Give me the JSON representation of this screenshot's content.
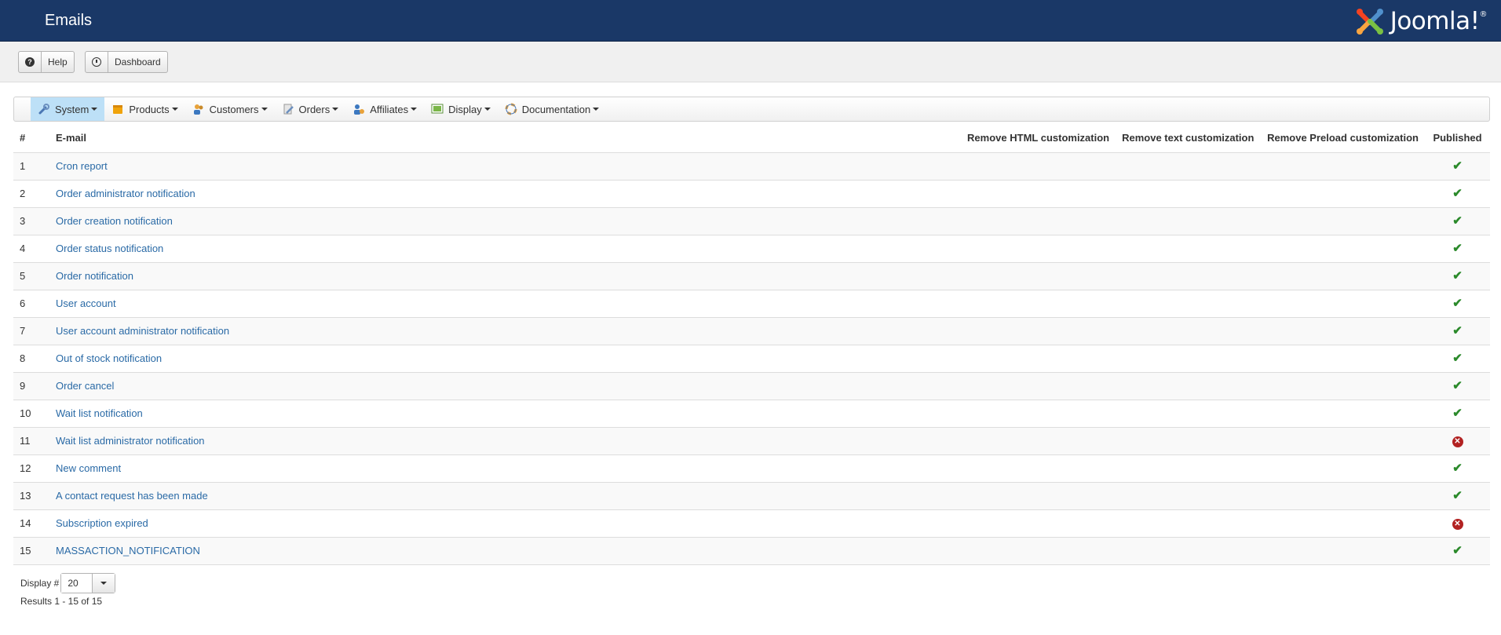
{
  "header": {
    "title": "Emails",
    "logo_text": "Joomla!"
  },
  "toolbar": {
    "help_label": "Help",
    "dashboard_label": "Dashboard"
  },
  "menu": [
    {
      "label": "System",
      "icon": "wrench-icon",
      "active": true
    },
    {
      "label": "Products",
      "icon": "box-icon"
    },
    {
      "label": "Customers",
      "icon": "users-icon"
    },
    {
      "label": "Orders",
      "icon": "pencil-icon"
    },
    {
      "label": "Affiliates",
      "icon": "affiliate-icon"
    },
    {
      "label": "Display",
      "icon": "monitor-icon"
    },
    {
      "label": "Documentation",
      "icon": "lifebuoy-icon"
    }
  ],
  "table": {
    "headers": {
      "num": "#",
      "email": "E-mail",
      "remove_html": "Remove HTML customization",
      "remove_text": "Remove text customization",
      "remove_preload": "Remove Preload customization",
      "published": "Published"
    },
    "rows": [
      {
        "num": "1",
        "email": "Cron report",
        "published": true
      },
      {
        "num": "2",
        "email": "Order administrator notification",
        "published": true
      },
      {
        "num": "3",
        "email": "Order creation notification",
        "published": true
      },
      {
        "num": "4",
        "email": "Order status notification",
        "published": true
      },
      {
        "num": "5",
        "email": "Order notification",
        "published": true
      },
      {
        "num": "6",
        "email": "User account",
        "published": true
      },
      {
        "num": "7",
        "email": "User account administrator notification",
        "published": true
      },
      {
        "num": "8",
        "email": "Out of stock notification",
        "published": true
      },
      {
        "num": "9",
        "email": "Order cancel",
        "published": true
      },
      {
        "num": "10",
        "email": "Wait list notification",
        "published": true
      },
      {
        "num": "11",
        "email": "Wait list administrator notification",
        "published": false
      },
      {
        "num": "12",
        "email": "New comment",
        "published": true
      },
      {
        "num": "13",
        "email": "A contact request has been made",
        "published": true
      },
      {
        "num": "14",
        "email": "Subscription expired",
        "published": false
      },
      {
        "num": "15",
        "email": "MASSACTION_NOTIFICATION",
        "published": true
      }
    ]
  },
  "footer": {
    "display_label": "Display #",
    "display_value": "20",
    "results": "Results 1 - 15 of 15"
  },
  "colors": {
    "header_bg": "#1a3867",
    "link": "#2a6aa6",
    "check": "#2b8a2b",
    "unpublished": "#b22222",
    "active_menu": "#bde0f7"
  }
}
